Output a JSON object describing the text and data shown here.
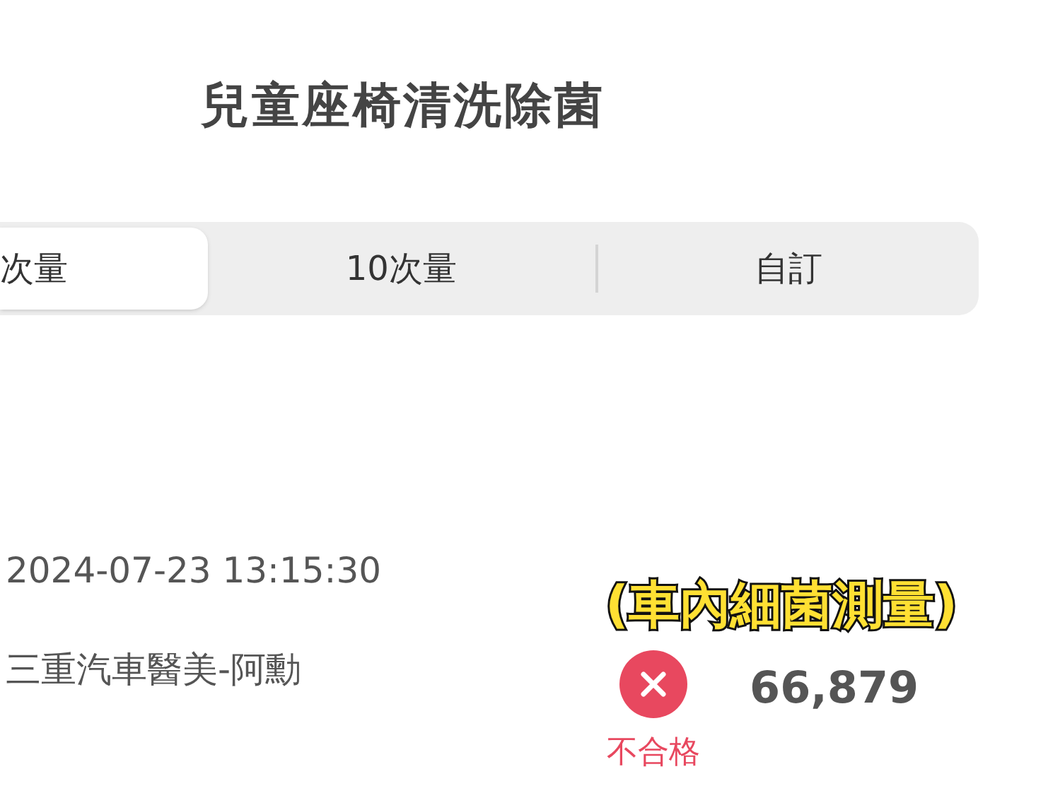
{
  "title": "兒童座椅清洗除菌",
  "tabs": [
    {
      "label": "次量",
      "selected": true
    },
    {
      "label": "10次量",
      "selected": false
    },
    {
      "label": "自訂",
      "selected": false
    }
  ],
  "record": {
    "datetime": "2024-07-23 13:15:30",
    "location": "三重汽車醫美-阿勳",
    "passed": false,
    "result": "不合格",
    "count": "66,879"
  },
  "caption": "(車內細菌測量)"
}
